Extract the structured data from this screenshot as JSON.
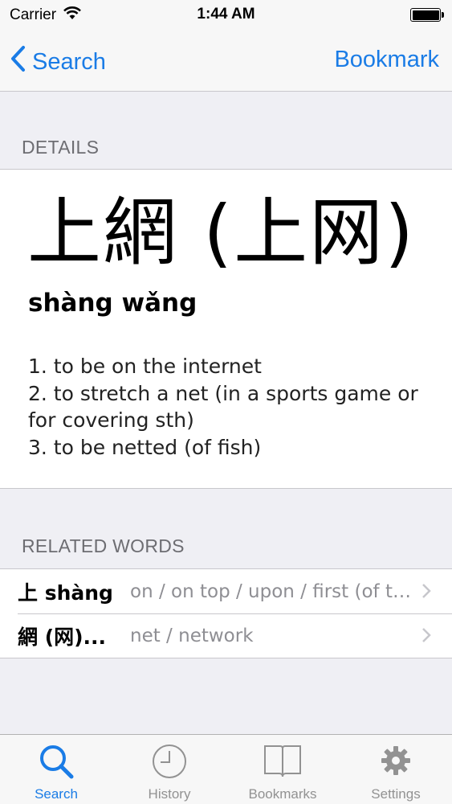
{
  "status_bar": {
    "carrier": "Carrier",
    "time": "1:44 AM"
  },
  "nav": {
    "back_label": "Search",
    "right_label": "Bookmark"
  },
  "details": {
    "section_header": "DETAILS",
    "headword": "上網 (上网)",
    "pinyin": "shàng wǎng",
    "definitions": [
      "1. to be on the internet",
      "2.  to stretch a net (in a sports game or for covering sth)",
      "3.  to be netted (of fish)"
    ]
  },
  "related": {
    "section_header": "RELATED WORDS",
    "items": [
      {
        "word": "上  shàng",
        "meaning": "on / on top / upon / first (of two parts)"
      },
      {
        "word": "網 (网)...",
        "meaning": "net / network"
      }
    ]
  },
  "tabs": [
    {
      "label": "Search",
      "icon": "search-icon",
      "active": true
    },
    {
      "label": "History",
      "icon": "clock-icon",
      "active": false
    },
    {
      "label": "Bookmarks",
      "icon": "book-icon",
      "active": false
    },
    {
      "label": "Settings",
      "icon": "gear-icon",
      "active": false
    }
  ],
  "colors": {
    "accent": "#1a7ce6",
    "background": "#efeff4",
    "tab_inactive": "#929292"
  }
}
